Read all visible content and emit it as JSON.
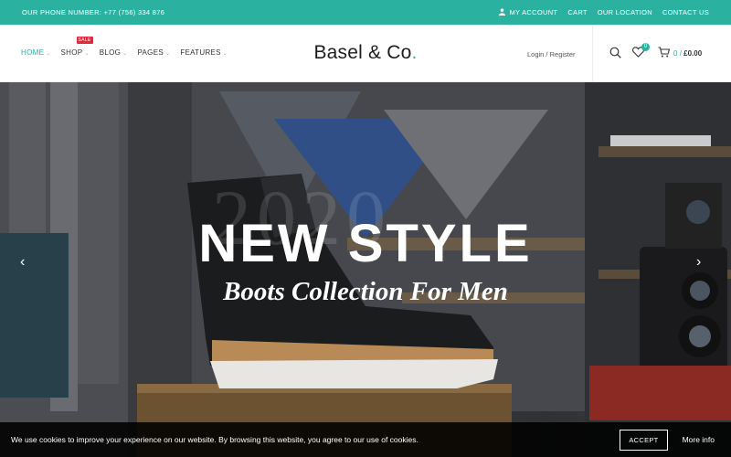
{
  "topbar": {
    "phone": "OUR PHONE NUMBER: +77 (756) 334 876",
    "links": [
      "MY ACCOUNT",
      "CART",
      "OUR LOCATION",
      "CONTACT US"
    ]
  },
  "nav": {
    "items": [
      {
        "label": "HOME"
      },
      {
        "label": "SHOP",
        "badge": "SALE"
      },
      {
        "label": "BLOG"
      },
      {
        "label": "PAGES"
      },
      {
        "label": "FEATURES"
      }
    ]
  },
  "logo": {
    "text": "Basel & Co",
    "dot": "."
  },
  "header": {
    "login_label": "Login / Register",
    "wishlist_count": "0",
    "cart_count": "0",
    "cart_sep": "/",
    "cart_total": "£0.00"
  },
  "hero": {
    "year": "2020",
    "headline": "NEW STYLE",
    "subline": "Boots Collection For Men",
    "prev_arrow": "‹",
    "next_arrow": "›"
  },
  "cookie": {
    "message": "We use cookies to improve your experience on our website. By browsing this website, you agree to our use of cookies.",
    "accept_label": "ACCEPT",
    "more_label": "More info"
  },
  "colors": {
    "accent": "#2bb1a0",
    "sale": "#e3293b"
  }
}
